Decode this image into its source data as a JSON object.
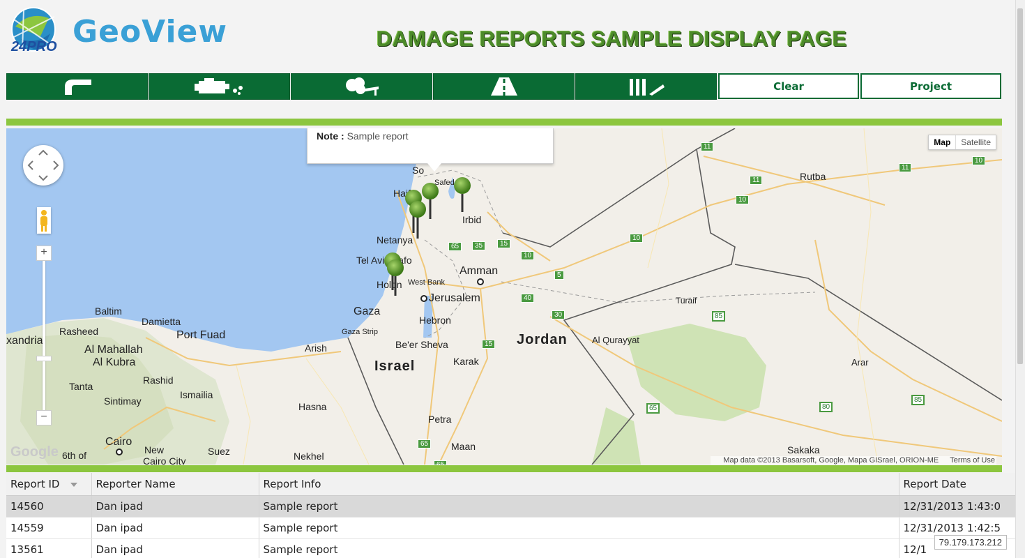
{
  "header": {
    "logo_text": "GeoView",
    "logo_badge": "24PRO",
    "title": "DAMAGE REPORTS SAMPLE DISPLAY PAGE"
  },
  "toolbar": {
    "icon_buttons": [
      "water-pipe-icon",
      "engine-icon",
      "tree-damage-icon",
      "road-icon",
      "fence-icon"
    ],
    "clear_label": "Clear",
    "project_label": "Project"
  },
  "map": {
    "popup": {
      "key": "Note :",
      "value": "Sample report"
    },
    "type_map": "Map",
    "type_satellite": "Satellite",
    "zoom_in": "+",
    "zoom_out": "−",
    "attribution": "Map data ©2013 Basarsoft, Google, Mapa GISrael, ORION-ME",
    "terms": "Terms of Use",
    "google": "Google",
    "labels": {
      "jordan": "Jordan",
      "israel": "Israel",
      "amman": "Amman",
      "jerusalem": "Jerusalem",
      "tel_aviv": "Tel Aviv-Yafo",
      "holon": "Holon",
      "netanya": "Netanya",
      "haifa": "Haifa",
      "safed": "Safed",
      "irbid": "Irbid",
      "so": "So",
      "west_bank": "West Bank",
      "gaza": "Gaza",
      "gaza_strip": "Gaza Strip",
      "hebron": "Hebron",
      "beer_sheva": "Be'er Sheva",
      "karak": "Karak",
      "arish": "Arish",
      "petra": "Petra",
      "maan": "Maan",
      "hasna": "Hasna",
      "nekhel": "Nekhel",
      "suez": "Suez",
      "ismailia": "Ismailia",
      "cairo": "Cairo",
      "new_cairo": "New",
      "new_cairo2": "Cairo City",
      "sixth_oct": "6th of",
      "baltim": "Baltim",
      "damietta": "Damietta",
      "port_fuad": "Port Fuad",
      "rasheed": "Rasheed",
      "alexandria": "xandria",
      "al_mahallah": "Al Mahallah",
      "al_kubra": "Al Kubra",
      "tanta": "Tanta",
      "rashid": "Rashid",
      "sintimay": "Sintimay",
      "rutba": "Rutba",
      "turaif": "Turaif",
      "al_qurayyat": "Al Qurayyat",
      "arar": "Arar",
      "sakaka": "Sakaka"
    },
    "road_shields": [
      "11",
      "11",
      "10",
      "11",
      "10",
      "10",
      "10",
      "5",
      "15",
      "35",
      "65",
      "30",
      "40",
      "15",
      "85",
      "65",
      "80",
      "85",
      "65",
      "65"
    ]
  },
  "grid": {
    "columns": [
      "Report ID",
      "Reporter Name",
      "Report Info",
      "Report Date"
    ],
    "rows": [
      {
        "id": "14560",
        "name": "Dan ipad",
        "info": "Sample report",
        "date": "12/31/2013 1:43:0"
      },
      {
        "id": "14559",
        "name": "Dan ipad",
        "info": "Sample report",
        "date": "12/31/2013 1:42:5"
      },
      {
        "id": "13561",
        "name": "Dan ipad",
        "info": "Sample report",
        "date": "12/1"
      }
    ]
  },
  "status": {
    "ip": "79.179.173.212"
  },
  "colors": {
    "brand_green": "#0a6b34",
    "accent_lime": "#8cc63f",
    "sea": "#a3c7f1",
    "title_green": "#4c8a2a"
  }
}
